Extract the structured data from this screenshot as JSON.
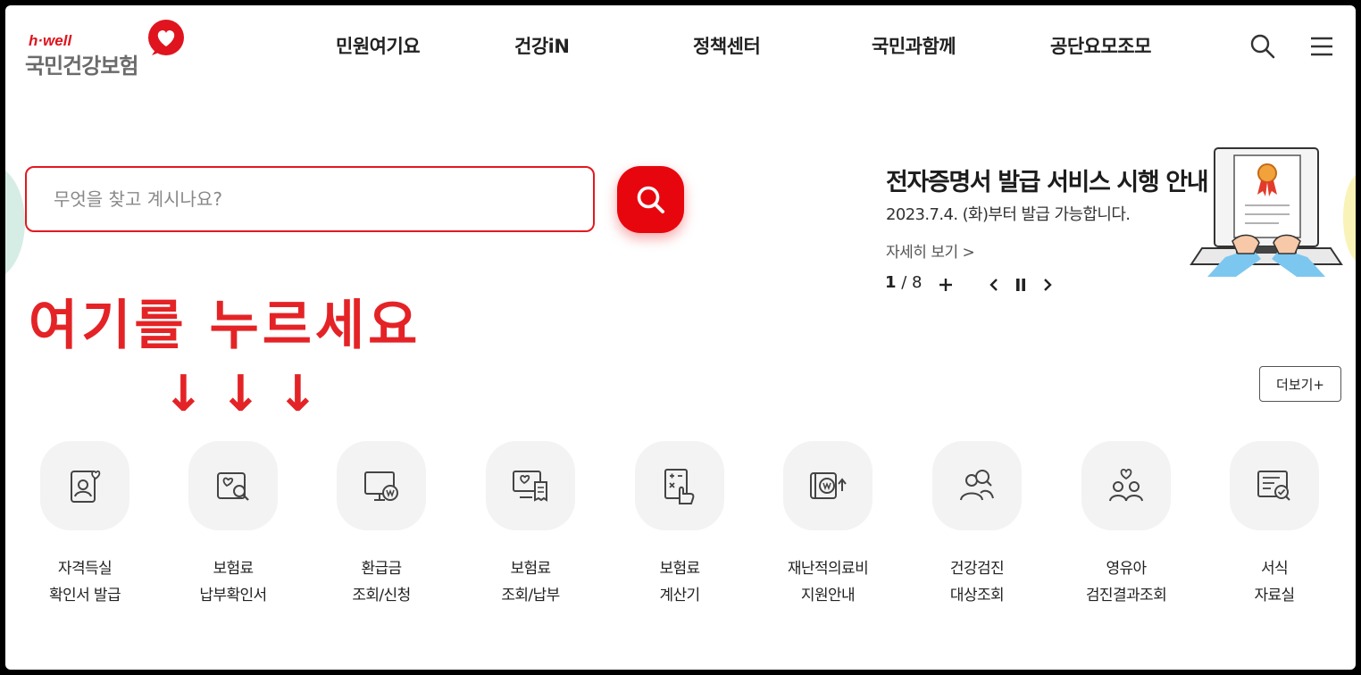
{
  "logo": {
    "brand_small": "h·well",
    "brand_main": "국민건강보험"
  },
  "nav": {
    "items": [
      {
        "label": "민원여기요"
      },
      {
        "label": "건강iN"
      },
      {
        "label": "정책센터"
      },
      {
        "label": "국민과함께"
      },
      {
        "label": "공단요모조모"
      }
    ],
    "icons": [
      "search-icon",
      "menu-icon"
    ]
  },
  "search": {
    "placeholder": "무엇을 찾고 계시나요?",
    "value": ""
  },
  "annotation": {
    "text": "여기를 누르세요",
    "arrow": "↓"
  },
  "banner": {
    "title": "전자증명서 발급 서비스 시행 안내",
    "subtitle": "2023.7.4. (화)부터 발급 가능합니다.",
    "more_link": "자세히 보기 >",
    "current_page": "1",
    "separator": " / ",
    "total_pages": "8"
  },
  "more_button": {
    "label": "더보기+"
  },
  "quick_menu": [
    {
      "line1": "자격득실",
      "line2": "확인서 발급",
      "icon": "id-card-icon"
    },
    {
      "line1": "보험료",
      "line2": "납부확인서",
      "icon": "document-search-icon"
    },
    {
      "line1": "환급금",
      "line2": "조회/신청",
      "icon": "monitor-won-icon"
    },
    {
      "line1": "보험료",
      "line2": "조회/납부",
      "icon": "monitor-receipt-icon"
    },
    {
      "line1": "보험료",
      "line2": "계산기",
      "icon": "calculator-icon"
    },
    {
      "line1": "재난적의료비",
      "line2": "지원안내",
      "icon": "wallet-won-icon"
    },
    {
      "line1": "건강검진",
      "line2": "대상조회",
      "icon": "people-search-icon"
    },
    {
      "line1": "영유아",
      "line2": "검진결과조회",
      "icon": "family-heart-icon"
    },
    {
      "line1": "서식",
      "line2": "자료실",
      "icon": "form-document-icon"
    }
  ],
  "colors": {
    "accent": "#e8060e",
    "annotation": "#e42326",
    "icon_bg": "#f3f3f3"
  }
}
